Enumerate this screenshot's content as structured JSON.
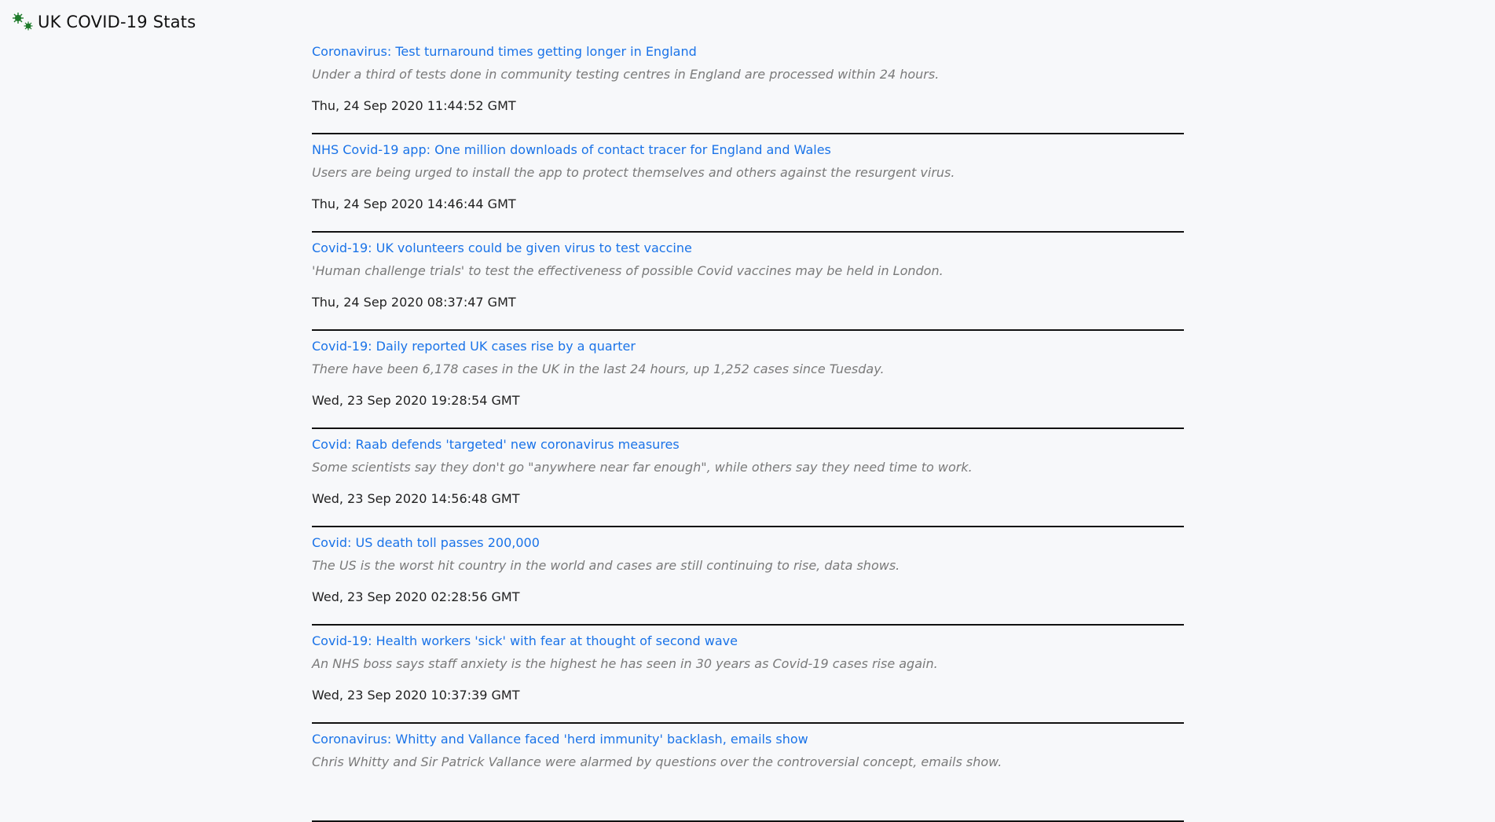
{
  "header": {
    "title": "UK COVID-19 Stats",
    "logo_icon": "virus-icon",
    "accent_color": "#1a73e8",
    "logo_color": "#1e7a2a"
  },
  "articles": [
    {
      "title": "Coronavirus: Test turnaround times getting longer in England",
      "description": "Under a third of tests done in community testing centres in England are processed within 24 hours.",
      "date": "Thu, 24 Sep 2020 11:44:52 GMT"
    },
    {
      "title": "NHS Covid-19 app: One million downloads of contact tracer for England and Wales",
      "description": "Users are being urged to install the app to protect themselves and others against the resurgent virus.",
      "date": "Thu, 24 Sep 2020 14:46:44 GMT"
    },
    {
      "title": "Covid-19: UK volunteers could be given virus to test vaccine",
      "description": "'Human challenge trials' to test the effectiveness of possible Covid vaccines may be held in London.",
      "date": "Thu, 24 Sep 2020 08:37:47 GMT"
    },
    {
      "title": "Covid-19: Daily reported UK cases rise by a quarter",
      "description": "There have been 6,178 cases in the UK in the last 24 hours, up 1,252 cases since Tuesday.",
      "date": "Wed, 23 Sep 2020 19:28:54 GMT"
    },
    {
      "title": "Covid: Raab defends 'targeted' new coronavirus measures",
      "description": "Some scientists say they don't go \"anywhere near far enough\", while others say they need time to work.",
      "date": "Wed, 23 Sep 2020 14:56:48 GMT"
    },
    {
      "title": "Covid: US death toll passes 200,000",
      "description": "The US is the worst hit country in the world and cases are still continuing to rise, data shows.",
      "date": "Wed, 23 Sep 2020 02:28:56 GMT"
    },
    {
      "title": "Covid-19: Health workers 'sick' with fear at thought of second wave",
      "description": "An NHS boss says staff anxiety is the highest he has seen in 30 years as Covid-19 cases rise again.",
      "date": "Wed, 23 Sep 2020 10:37:39 GMT"
    },
    {
      "title": "Coronavirus: Whitty and Vallance faced 'herd immunity' backlash, emails show",
      "description": "Chris Whitty and Sir Patrick Vallance were alarmed by questions over the controversial concept, emails show.",
      "date": ""
    }
  ]
}
